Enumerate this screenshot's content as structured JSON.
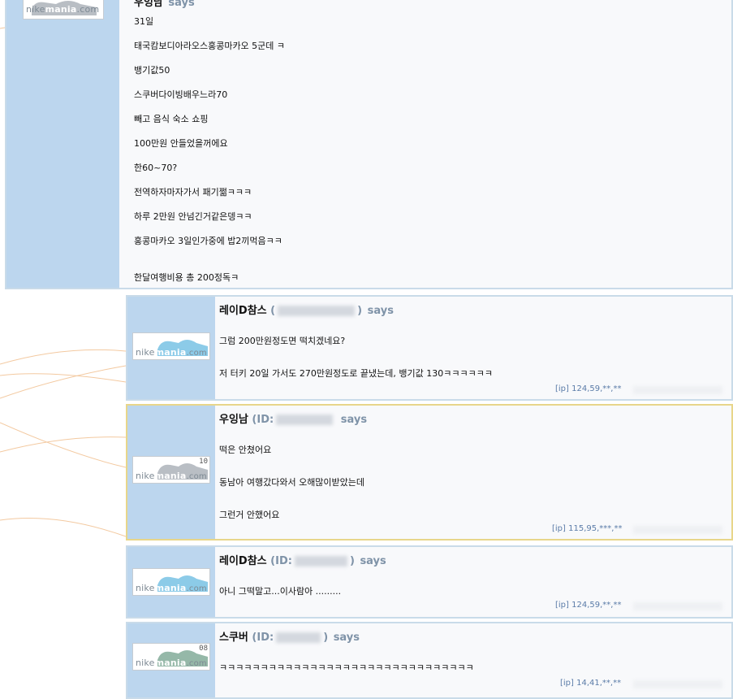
{
  "first_post": {
    "author": "우잉남",
    "says": "says",
    "logo": "nikemania.com",
    "lines": [
      "31일",
      "태국캄보디아라오스홍콩마카오 5군데 ㅋ",
      "뱅기값50",
      "스쿠버다이빙배우느라70",
      "빼고 음식 숙소 쇼핑",
      "100만원 안들었을꺼에요",
      "한60~70?",
      "전역하자마자가서 패기쩖ㅋㅋㅋ",
      "하루 2만원 안넘긴거같은뎅ㅋㅋ",
      "홍콩마카오 3일인가중에 밥2끼먹음ㅋㅋ",
      "한달여행비용 총 200정독ㅋ"
    ]
  },
  "replies": [
    {
      "author": "레이D참스",
      "id_prefix": "(",
      "id_suffix": ")",
      "says": "says",
      "logo_word": "nike",
      "logo_bold": "mania",
      "logo_dom": ".com",
      "level": "",
      "lines": [
        "그럼 200만원정도면 떡치겠네요?",
        "저 터키 20일 가서도 270만원정도로 끝냈는데, 뱅기값 130ㅋㅋㅋㅋㅋㅋ"
      ],
      "ip": "[ip] 124,59,**,**"
    },
    {
      "author": "우잉남",
      "id_prefix": "(ID:",
      "id_suffix": "",
      "says": "says",
      "logo_word": "nike",
      "logo_bold": "mania",
      "logo_dom": ".com",
      "level": "10",
      "lines": [
        "떡은 안쳤어요",
        "동남아 여행갔다와서 오해많이받았는데",
        "그런거 안했어요"
      ],
      "ip": "[ip] 115,95,***,**"
    },
    {
      "author": "레이D참스",
      "id_prefix": "(ID:",
      "id_suffix": ")",
      "says": "says",
      "logo_word": "nike",
      "logo_bold": "mania",
      "logo_dom": ".com",
      "level": "",
      "lines": [
        "아니 그떡말고...이사람아 ........."
      ],
      "ip": "[ip] 124,59,**,**"
    },
    {
      "author": "스쿠버",
      "id_prefix": "(ID:",
      "id_suffix": ")",
      "says": "says",
      "logo_word": "nike",
      "logo_bold": "mania",
      "logo_dom": ".com",
      "level": "08",
      "lines": [
        "ㅋㅋㅋㅋㅋㅋㅋㅋㅋㅋㅋㅋㅋㅋㅋㅋㅋㅋㅋㅋㅋㅋㅋㅋㅋㅋㅋㅋㅋㅋㅋ"
      ],
      "ip": "[ip] 14,41,**,**"
    }
  ],
  "colors": {
    "sidebar": "#bcd6ee",
    "border": "#c9dbe9",
    "highlight_border": "#e8d68a",
    "shoe_blue": "#8ccbe8",
    "shoe_gray": "#b9bec4",
    "shoe_green": "#95b8a8",
    "ip_text": "#5b7ca8"
  }
}
